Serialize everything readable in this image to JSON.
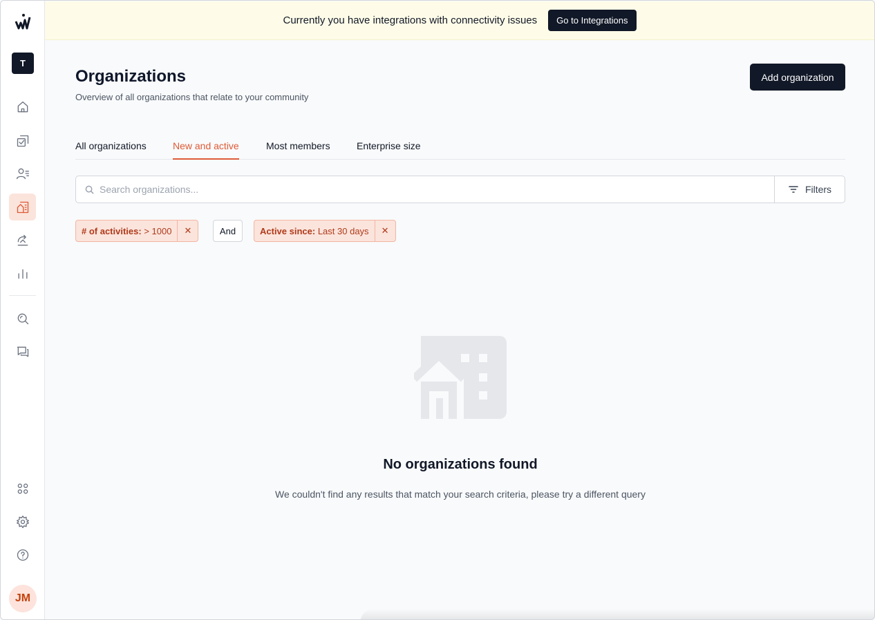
{
  "sidebar": {
    "workspace_initial": "T",
    "user_initials": "JM",
    "nav_items": [
      {
        "name": "home-icon"
      },
      {
        "name": "activities-icon"
      },
      {
        "name": "members-icon"
      },
      {
        "name": "organizations-icon",
        "active": true
      },
      {
        "name": "eagle-eye-icon"
      },
      {
        "name": "reports-icon"
      },
      {
        "name": "search-icon"
      },
      {
        "name": "conversations-icon"
      },
      {
        "name": "integrations-icon"
      },
      {
        "name": "settings-icon"
      },
      {
        "name": "help-icon"
      }
    ]
  },
  "banner": {
    "text": "Currently you have integrations with connectivity issues",
    "button_label": "Go to Integrations"
  },
  "header": {
    "title": "Organizations",
    "subtitle": "Overview of all organizations that relate to your community",
    "add_button_label": "Add organization"
  },
  "tabs": [
    {
      "label": "All organizations",
      "active": false
    },
    {
      "label": "New and active",
      "active": true
    },
    {
      "label": "Most members",
      "active": false
    },
    {
      "label": "Enterprise size",
      "active": false
    }
  ],
  "search": {
    "placeholder": "Search organizations...",
    "value": ""
  },
  "filters_button_label": "Filters",
  "filter_chips": [
    {
      "field": "# of activities:",
      "value": "> 1000"
    },
    {
      "field": "Active since:",
      "value": "Last 30 days"
    }
  ],
  "operator_label": "And",
  "empty_state": {
    "title": "No organizations found",
    "message": "We couldn't find any results that match your search criteria, please try a different query",
    "icon": "building-icon"
  },
  "colors": {
    "accent": "#de5a36",
    "chip_bg": "#fbe4dc",
    "banner_bg": "#fefce8",
    "dark": "#111827"
  }
}
